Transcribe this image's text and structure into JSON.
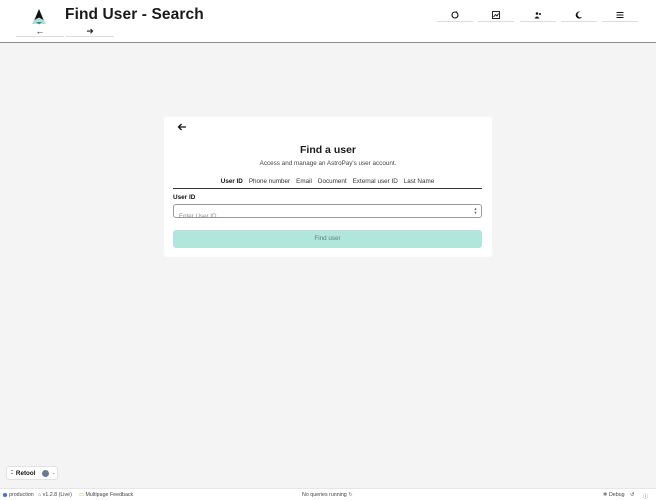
{
  "header": {
    "title": "Find User - Search",
    "back_label": "←",
    "forward_label": "➜",
    "logo_color": "#1f9e8b"
  },
  "card": {
    "title": "Find a user",
    "subtitle": "Access and manage an AstroPay's user account.",
    "tabs": [
      "User ID",
      "Phone number",
      "Email",
      "Document",
      "External user ID",
      "Last Name"
    ],
    "active_tab": "User ID",
    "field_label": "User ID",
    "field_placeholder": "Enter User ID...",
    "field_value": "",
    "submit_label": "Find user",
    "submit_color": "#b1e6dc"
  },
  "retool_badge": {
    "label": "Retool"
  },
  "footer": {
    "environment": "production",
    "version": "v1.2.8 (Live)",
    "feedback": "Multipage Feedback",
    "queries": "No queries running",
    "debug": "Debug"
  }
}
